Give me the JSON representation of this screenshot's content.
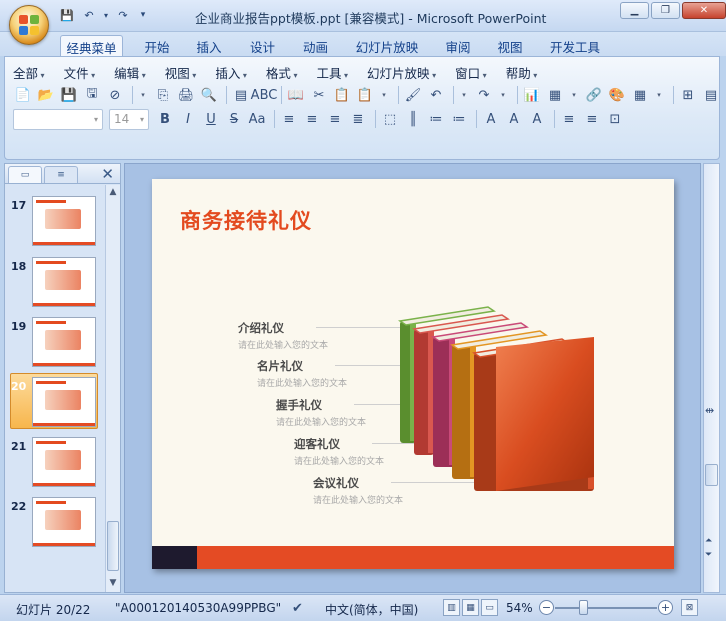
{
  "window": {
    "title": "企业商业报告ppt模板.ppt [兼容模式] - Microsoft PowerPoint",
    "minimize": "▁",
    "maximize": "❐",
    "close": "✕"
  },
  "quick_access": {
    "save": "💾",
    "undo": "↶",
    "undo_drop": "▾",
    "redo": "↷",
    "customize": "▾"
  },
  "ribbon_tabs": [
    "经典菜单",
    "开始",
    "插入",
    "设计",
    "动画",
    "幻灯片放映",
    "审阅",
    "视图",
    "开发工具"
  ],
  "active_tab": "经典菜单",
  "menus": [
    "全部",
    "文件",
    "编辑",
    "视图",
    "插入",
    "格式",
    "工具",
    "幻灯片放映",
    "窗口",
    "帮助"
  ],
  "toolbar1": [
    "📄",
    "📂",
    "💾",
    "🖫",
    "⊘",
    "▾",
    "⎘",
    "🖨",
    "🔍",
    "▤",
    "ABC",
    "📖",
    "✂",
    "📋",
    "📋",
    "▾",
    "🖌",
    "↶",
    "▾",
    "↷",
    "▾",
    "📊",
    "▦",
    "▾",
    "🔗",
    "🎨",
    "▦",
    "▾",
    "⊞",
    "▤",
    "▾",
    "▸"
  ],
  "toolbar2": {
    "font_name": "",
    "font_size": "14",
    "buttons": [
      "B",
      "I",
      "U",
      "S",
      "Aa",
      "≡",
      "≡",
      "≡",
      "≣",
      "⬚",
      "║",
      "≔",
      "≔",
      "A",
      "A",
      "A",
      "≡",
      "≡",
      "⊡"
    ]
  },
  "thumbnails": [
    {
      "num": "17"
    },
    {
      "num": "18"
    },
    {
      "num": "19"
    },
    {
      "num": "20",
      "active": true
    },
    {
      "num": "21"
    },
    {
      "num": "22"
    }
  ],
  "slide": {
    "title": "商务接待礼仪",
    "items": [
      {
        "heading": "介绍礼仪",
        "text": "请在此处输入您的文本"
      },
      {
        "heading": "名片礼仪",
        "text": "请在此处输入您的文本"
      },
      {
        "heading": "握手礼仪",
        "text": "请在此处输入您的文本"
      },
      {
        "heading": "迎客礼仪",
        "text": "请在此处输入您的文本"
      },
      {
        "heading": "会议礼仪",
        "text": "请在此处输入您的文本"
      }
    ],
    "colors": {
      "accent": "#e34a1f",
      "footer_dark": "#1e1a2e",
      "footer_orange": "#e44b24",
      "background": "#fbf8ee"
    },
    "books": [
      {
        "face": "#7ab24a",
        "spine": "#5a8e2e"
      },
      {
        "face": "#d9584f",
        "spine": "#b23a32"
      },
      {
        "face": "#c94a78",
        "spine": "#9c2f57"
      },
      {
        "face": "#e39623",
        "spine": "#b56f12"
      },
      {
        "face": "#d8512a",
        "spine": "#a83a18"
      }
    ]
  },
  "status": {
    "slide_info": "幻灯片 20/22",
    "theme": "\"A000120140530A99PPBG\"",
    "language": "中文(简体，中国)",
    "zoom": "54%",
    "zoom_fraction": 0.54
  }
}
